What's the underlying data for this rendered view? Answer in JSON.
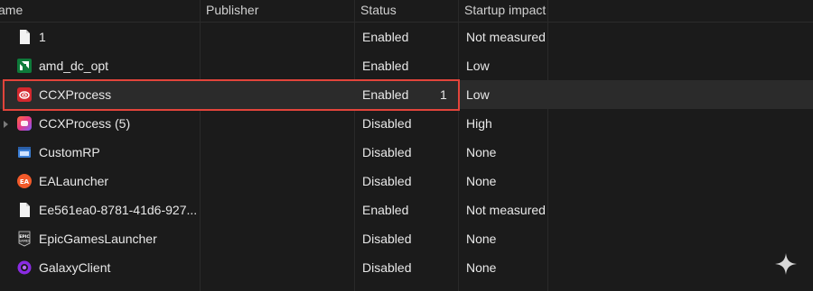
{
  "header": {
    "name": "ame",
    "publisher": "Publisher",
    "status": "Status",
    "impact": "Startup impact"
  },
  "rows": [
    {
      "name": "1",
      "status": "Enabled",
      "impact": "Not measured",
      "icon": "blank-file-icon"
    },
    {
      "name": "amd_dc_opt",
      "status": "Enabled",
      "impact": "Low",
      "icon": "amd-icon"
    },
    {
      "name": "CCXProcess",
      "status": "Enabled",
      "impact": "Low",
      "count": "1",
      "icon": "adobe-cc-icon",
      "selected": true
    },
    {
      "name": "CCXProcess (5)",
      "status": "Disabled",
      "impact": "High",
      "icon": "ccx-gradient-icon",
      "expandable": true
    },
    {
      "name": "CustomRP",
      "status": "Disabled",
      "impact": "None",
      "icon": "generic-app-icon"
    },
    {
      "name": "EALauncher",
      "status": "Disabled",
      "impact": "None",
      "icon": "ea-icon"
    },
    {
      "name": "Ee561ea0-8781-41d6-927...",
      "status": "Enabled",
      "impact": "Not measured",
      "icon": "blank-file-icon"
    },
    {
      "name": "EpicGamesLauncher",
      "status": "Disabled",
      "impact": "None",
      "icon": "epic-games-icon"
    },
    {
      "name": "GalaxyClient",
      "status": "Disabled",
      "impact": "None",
      "icon": "galaxy-icon"
    }
  ],
  "colors": {
    "background": "#1b1b1b",
    "selected_row": "#2b2b2b",
    "highlight_border": "#e2443b",
    "text": "#e8e8e8"
  }
}
